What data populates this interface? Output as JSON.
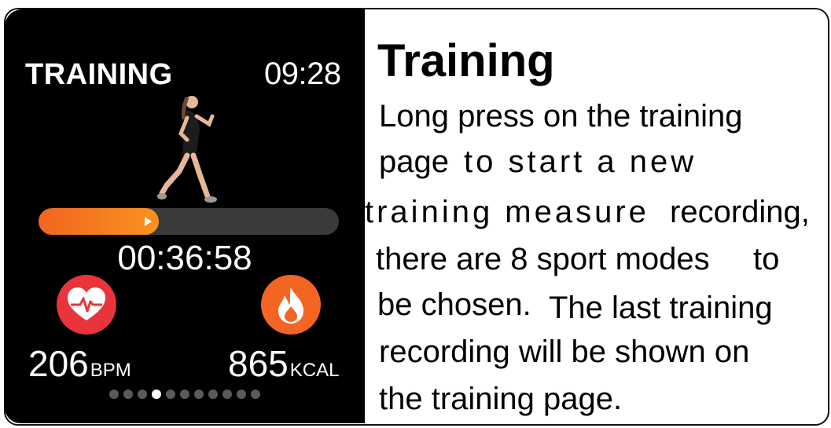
{
  "watch": {
    "title": "TRAINING",
    "time": "09:28",
    "progress_fraction": 0.4,
    "duration": "00:36:58",
    "heart_rate": {
      "value": "206",
      "unit": "BPM",
      "icon": "heart-rate-icon"
    },
    "calories": {
      "value": "865",
      "unit": "KCAL",
      "icon": "flame-icon"
    },
    "page_dots": {
      "count": 11,
      "active_index": 3
    },
    "colors": {
      "background": "#000000",
      "accent": "#f26522",
      "heart": "#e8343a"
    }
  },
  "description": {
    "title": "Training",
    "lines": [
      "Long press on the training",
      "page",
      "to start a new",
      "training measure",
      "recording,",
      "there are 8 sport modes",
      "to",
      "be chosen.",
      "The last training",
      "recording will be shown on",
      "the training page."
    ]
  }
}
